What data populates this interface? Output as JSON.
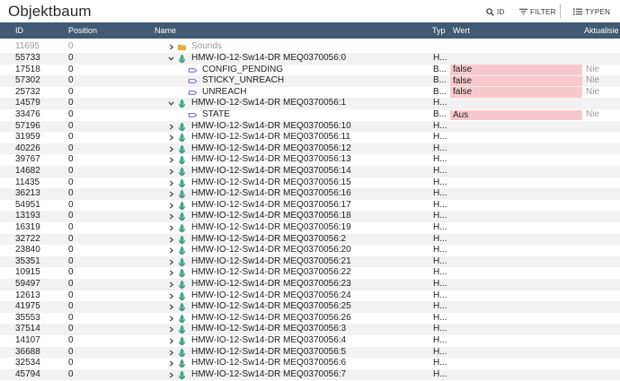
{
  "toolbar": {
    "title": "Objektbaum",
    "id_label": "ID",
    "filter_label": "FILTER",
    "types_label": "TYPEN"
  },
  "columns": {
    "id": "ID",
    "position": "Position",
    "name": "Name",
    "type": "Typ",
    "value": "Wert",
    "updated": "Aktualisie"
  },
  "rows": [
    {
      "id": "11695",
      "pos": "0",
      "name": "Sounds",
      "kind": "folder",
      "expand": "collapsed",
      "level": 0,
      "typ": "",
      "val": "",
      "ack": "",
      "partial": true
    },
    {
      "id": "55733",
      "pos": "0",
      "name": "HMW-IO-12-Sw14-DR MEQ0370056:0",
      "kind": "device",
      "expand": "expanded",
      "level": 0,
      "typ": "H...",
      "val": "",
      "ack": ""
    },
    {
      "id": "17518",
      "pos": "0",
      "name": "CONFIG_PENDING",
      "kind": "state",
      "expand": "none",
      "level": 1,
      "typ": "B...",
      "val": "false",
      "ack": "Nie"
    },
    {
      "id": "57302",
      "pos": "0",
      "name": "STICKY_UNREACH",
      "kind": "state",
      "expand": "none",
      "level": 1,
      "typ": "B...",
      "val": "false",
      "ack": "Nie"
    },
    {
      "id": "25732",
      "pos": "0",
      "name": "UNREACH",
      "kind": "state",
      "expand": "none",
      "level": 1,
      "typ": "B...",
      "val": "false",
      "ack": "Nie"
    },
    {
      "id": "14579",
      "pos": "0",
      "name": "HMW-IO-12-Sw14-DR MEQ0370056:1",
      "kind": "device",
      "expand": "expanded",
      "level": 0,
      "typ": "H...",
      "val": "",
      "ack": ""
    },
    {
      "id": "33476",
      "pos": "0",
      "name": "STATE",
      "kind": "state",
      "expand": "none",
      "level": 1,
      "typ": "B...",
      "val": "Aus",
      "ack": "Nie"
    },
    {
      "id": "57196",
      "pos": "0",
      "name": "HMW-IO-12-Sw14-DR MEQ0370056:10",
      "kind": "device",
      "expand": "collapsed",
      "level": 0,
      "typ": "H...",
      "val": "",
      "ack": ""
    },
    {
      "id": "31959",
      "pos": "0",
      "name": "HMW-IO-12-Sw14-DR MEQ0370056:11",
      "kind": "device",
      "expand": "collapsed",
      "level": 0,
      "typ": "H...",
      "val": "",
      "ack": ""
    },
    {
      "id": "40226",
      "pos": "0",
      "name": "HMW-IO-12-Sw14-DR MEQ0370056:12",
      "kind": "device",
      "expand": "collapsed",
      "level": 0,
      "typ": "H...",
      "val": "",
      "ack": ""
    },
    {
      "id": "39767",
      "pos": "0",
      "name": "HMW-IO-12-Sw14-DR MEQ0370056:13",
      "kind": "device",
      "expand": "collapsed",
      "level": 0,
      "typ": "H...",
      "val": "",
      "ack": ""
    },
    {
      "id": "14682",
      "pos": "0",
      "name": "HMW-IO-12-Sw14-DR MEQ0370056:14",
      "kind": "device",
      "expand": "collapsed",
      "level": 0,
      "typ": "H...",
      "val": "",
      "ack": ""
    },
    {
      "id": "11435",
      "pos": "0",
      "name": "HMW-IO-12-Sw14-DR MEQ0370056:15",
      "kind": "device",
      "expand": "collapsed",
      "level": 0,
      "typ": "H...",
      "val": "",
      "ack": ""
    },
    {
      "id": "36213",
      "pos": "0",
      "name": "HMW-IO-12-Sw14-DR MEQ0370056:16",
      "kind": "device",
      "expand": "collapsed",
      "level": 0,
      "typ": "H...",
      "val": "",
      "ack": ""
    },
    {
      "id": "54951",
      "pos": "0",
      "name": "HMW-IO-12-Sw14-DR MEQ0370056:17",
      "kind": "device",
      "expand": "collapsed",
      "level": 0,
      "typ": "H...",
      "val": "",
      "ack": ""
    },
    {
      "id": "13193",
      "pos": "0",
      "name": "HMW-IO-12-Sw14-DR MEQ0370056:18",
      "kind": "device",
      "expand": "collapsed",
      "level": 0,
      "typ": "H...",
      "val": "",
      "ack": ""
    },
    {
      "id": "16319",
      "pos": "0",
      "name": "HMW-IO-12-Sw14-DR MEQ0370056:19",
      "kind": "device",
      "expand": "collapsed",
      "level": 0,
      "typ": "H...",
      "val": "",
      "ack": ""
    },
    {
      "id": "32722",
      "pos": "0",
      "name": "HMW-IO-12-Sw14-DR MEQ0370056:2",
      "kind": "device",
      "expand": "collapsed",
      "level": 0,
      "typ": "H...",
      "val": "",
      "ack": ""
    },
    {
      "id": "23840",
      "pos": "0",
      "name": "HMW-IO-12-Sw14-DR MEQ0370056:20",
      "kind": "device",
      "expand": "collapsed",
      "level": 0,
      "typ": "H...",
      "val": "",
      "ack": ""
    },
    {
      "id": "35351",
      "pos": "0",
      "name": "HMW-IO-12-Sw14-DR MEQ0370056:21",
      "kind": "device",
      "expand": "collapsed",
      "level": 0,
      "typ": "H...",
      "val": "",
      "ack": ""
    },
    {
      "id": "10915",
      "pos": "0",
      "name": "HMW-IO-12-Sw14-DR MEQ0370056:22",
      "kind": "device",
      "expand": "collapsed",
      "level": 0,
      "typ": "H...",
      "val": "",
      "ack": ""
    },
    {
      "id": "59497",
      "pos": "0",
      "name": "HMW-IO-12-Sw14-DR MEQ0370056:23",
      "kind": "device",
      "expand": "collapsed",
      "level": 0,
      "typ": "H...",
      "val": "",
      "ack": ""
    },
    {
      "id": "12613",
      "pos": "0",
      "name": "HMW-IO-12-Sw14-DR MEQ0370056:24",
      "kind": "device",
      "expand": "collapsed",
      "level": 0,
      "typ": "H...",
      "val": "",
      "ack": ""
    },
    {
      "id": "41975",
      "pos": "0",
      "name": "HMW-IO-12-Sw14-DR MEQ0370056:25",
      "kind": "device",
      "expand": "collapsed",
      "level": 0,
      "typ": "H...",
      "val": "",
      "ack": ""
    },
    {
      "id": "35553",
      "pos": "0",
      "name": "HMW-IO-12-Sw14-DR MEQ0370056:26",
      "kind": "device",
      "expand": "collapsed",
      "level": 0,
      "typ": "H...",
      "val": "",
      "ack": ""
    },
    {
      "id": "37514",
      "pos": "0",
      "name": "HMW-IO-12-Sw14-DR MEQ0370056:3",
      "kind": "device",
      "expand": "collapsed",
      "level": 0,
      "typ": "H...",
      "val": "",
      "ack": ""
    },
    {
      "id": "14107",
      "pos": "0",
      "name": "HMW-IO-12-Sw14-DR MEQ0370056:4",
      "kind": "device",
      "expand": "collapsed",
      "level": 0,
      "typ": "H...",
      "val": "",
      "ack": ""
    },
    {
      "id": "36688",
      "pos": "0",
      "name": "HMW-IO-12-Sw14-DR MEQ0370056:5",
      "kind": "device",
      "expand": "collapsed",
      "level": 0,
      "typ": "H...",
      "val": "",
      "ack": ""
    },
    {
      "id": "32534",
      "pos": "0",
      "name": "HMW-IO-12-Sw14-DR MEQ0370056:6",
      "kind": "device",
      "expand": "collapsed",
      "level": 0,
      "typ": "H...",
      "val": "",
      "ack": ""
    },
    {
      "id": "45794",
      "pos": "0",
      "name": "HMW-IO-12-Sw14-DR MEQ0370056:7",
      "kind": "device",
      "expand": "collapsed",
      "level": 0,
      "typ": "H...",
      "val": "",
      "ack": ""
    }
  ],
  "colors": {
    "header_bg": "#3f5a72",
    "value_highlight": "#f8c9cc",
    "device_icon": "#4aa58e",
    "state_icon": "#8e6fc4",
    "folder_icon": "#e0b040"
  }
}
